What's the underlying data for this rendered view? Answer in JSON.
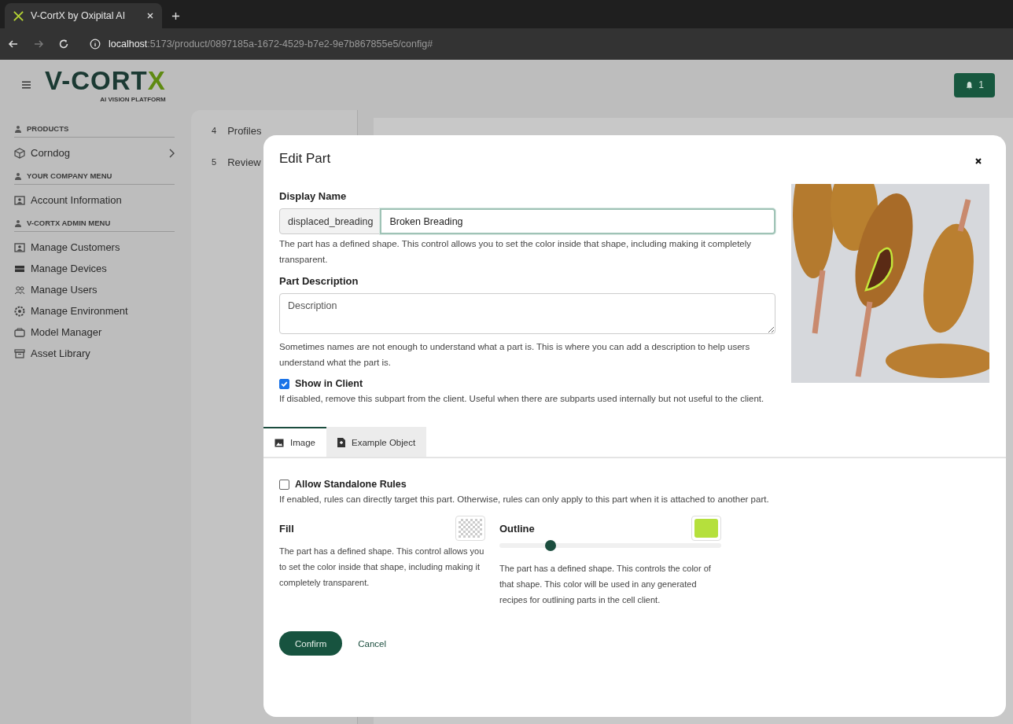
{
  "browser": {
    "tab_title": "V-CortX by Oxipital AI",
    "url_host": "localhost",
    "url_rest": ":5173/product/0897185a-1672-4529-b7e2-9e7b867855e5/config#"
  },
  "header": {
    "logo": {
      "wordmark": "V-CORT",
      "accent": "X",
      "tagline": "AI VISION PLATFORM"
    },
    "notifications": "1"
  },
  "sidebar": [
    {
      "heading": "PRODUCTS",
      "items": [
        {
          "label": "Corndog",
          "chevron": true
        }
      ]
    },
    {
      "heading": "YOUR COMPANY MENU",
      "items": [
        {
          "label": "Account Information",
          "chevron": false
        }
      ]
    },
    {
      "heading": "V-CORTX ADMIN MENU",
      "items": [
        {
          "label": "Manage Customers",
          "chevron": false
        },
        {
          "label": "Manage Devices",
          "chevron": false
        },
        {
          "label": "Manage Users",
          "chevron": false
        },
        {
          "label": "Manage Environment",
          "chevron": false
        },
        {
          "label": "Model Manager",
          "chevron": false
        },
        {
          "label": "Asset Library",
          "chevron": false
        }
      ]
    }
  ],
  "steps": [
    {
      "number": "4",
      "label": "Profiles"
    },
    {
      "number": "5",
      "label": "Review"
    }
  ],
  "modal": {
    "title": "Edit Part",
    "display_name": {
      "label": "Display Name",
      "prefix": "displaced_breading",
      "value": "Broken Breading",
      "help": "The part has a defined shape. This control allows you to set the color inside that shape, including making it completely transparent."
    },
    "description": {
      "label": "Part Description",
      "placeholder": "Description",
      "help": "Sometimes names are not enough to understand what a part is. This is where you can add a description to help users understand what the part is."
    },
    "show_in_client": {
      "label": "Show in Client",
      "checked": true,
      "help": "If disabled, remove this subpart from the client. Useful when there are subparts used internally but not useful to the client."
    },
    "tabs": [
      {
        "label": "Image",
        "selected": true
      },
      {
        "label": "Example Object",
        "selected": false
      }
    ],
    "allow_standalone": {
      "label": "Allow Standalone Rules",
      "checked": false,
      "help": "If enabled, rules can directly target this part. Otherwise, rules can only apply to this part when it is attached to another part."
    },
    "fill": {
      "label": "Fill",
      "help": "The part has a defined shape. This control allows you to set the color inside that shape, including making it completely transparent."
    },
    "outline": {
      "label": "Outline",
      "level": 0.23,
      "help": "The part has a defined shape. This controls the color of that shape. This color will be used in any generated recipes for outlining parts in the cell client."
    },
    "buttons": {
      "confirm": "Confirm",
      "cancel": "Cancel"
    }
  }
}
